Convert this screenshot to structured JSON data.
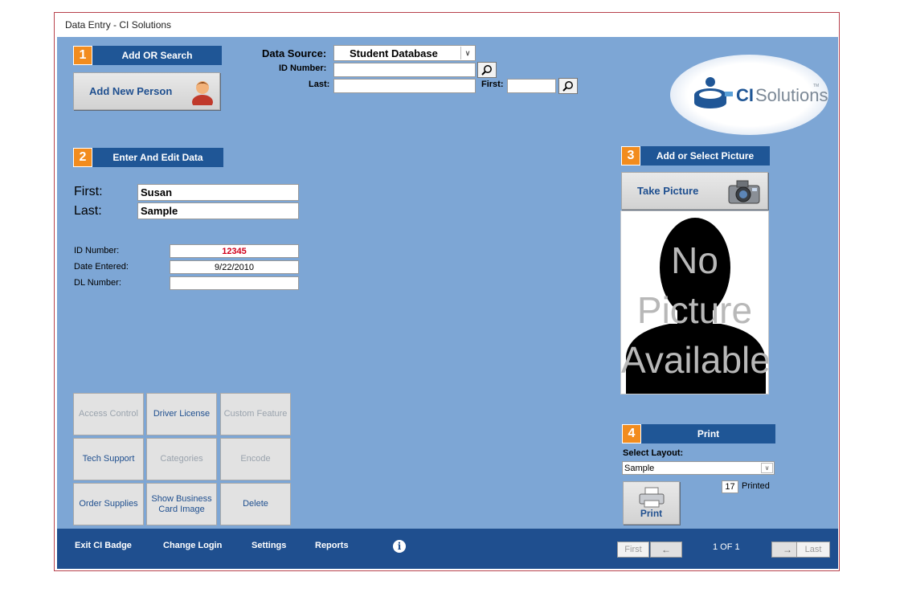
{
  "window": {
    "title": "Data Entry - CI Solutions"
  },
  "colors": {
    "panel_bg": "#7da6d5",
    "header_bg": "#1f5696",
    "accent_orange": "#f28c1e",
    "bottom_bar": "#1f4f8f",
    "id_red": "#d0021b"
  },
  "section1": {
    "number": "1",
    "title": "Add  OR  Search",
    "add_button": "Add New Person",
    "add_icon": "person-icon"
  },
  "search": {
    "data_source_label": "Data Source:",
    "data_source_value": "Student Database",
    "id_label": "ID Number:",
    "id_value": "",
    "last_label": "Last:",
    "last_value": "",
    "first_label": "First:",
    "first_value": "",
    "search_icon": "magnifier-icon"
  },
  "logo": {
    "brand_a": "CI",
    "brand_b": "Solutions",
    "trademark": "TM"
  },
  "section2": {
    "number": "2",
    "title": "Enter  And  Edit  Data",
    "first_label": "First:",
    "first_value": "Susan",
    "last_label": "Last:",
    "last_value": "Sample",
    "id_label": "ID Number:",
    "id_value": "12345",
    "date_label": "Date Entered:",
    "date_value": "9/22/2010",
    "dl_label": "DL Number:",
    "dl_value": ""
  },
  "section3": {
    "number": "3",
    "title": "Add or Select Picture",
    "take_picture": "Take Picture",
    "camera_icon": "camera-icon",
    "placeholder_line1": "No",
    "placeholder_line2": "Picture",
    "placeholder_line3": "Available"
  },
  "grid_buttons": {
    "b1": "Access Control",
    "b2": "Driver License",
    "b3": "Custom Feature",
    "b4": "Tech Support",
    "b5": "Categories",
    "b6": "Encode",
    "b7": "Order Supplies",
    "b8": "Show Business Card Image",
    "b9": "Delete"
  },
  "section4": {
    "number": "4",
    "title": "Print",
    "select_layout_label": "Select Layout:",
    "layout_value": "Sample",
    "printed_count": "17",
    "printed_label": "Printed",
    "print_button": "Print",
    "printer_icon": "printer-icon"
  },
  "bottom": {
    "exit": "Exit CI Badge",
    "change_login": "Change Login",
    "settings": "Settings",
    "reports": "Reports",
    "info_icon": "info-icon",
    "first": "First",
    "prev_arrow": "←",
    "record_position": "1  OF  1",
    "next_arrow": "→",
    "last": "Last"
  }
}
